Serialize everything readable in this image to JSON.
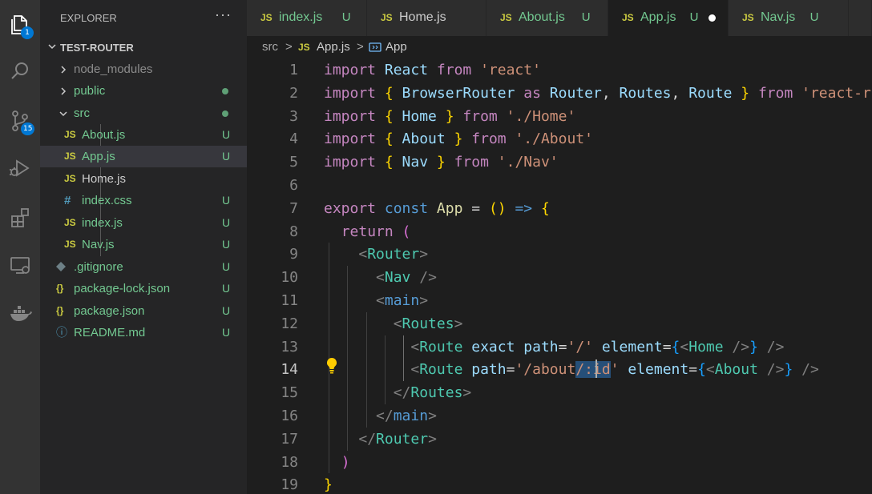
{
  "activity_bar": {
    "items": [
      {
        "icon": "explorer-icon",
        "badge": "1"
      },
      {
        "icon": "search-icon",
        "badge": ""
      },
      {
        "icon": "source-control-icon",
        "badge": "15"
      },
      {
        "icon": "run-debug-icon",
        "badge": ""
      },
      {
        "icon": "extensions-icon",
        "badge": ""
      },
      {
        "icon": "remote-explorer-icon",
        "badge": ""
      },
      {
        "icon": "docker-icon",
        "badge": ""
      }
    ],
    "badge_color": "#0078d4"
  },
  "sidebar": {
    "title": "EXPLORER",
    "more": "···",
    "root": "TEST-ROUTER",
    "rows": [
      {
        "name": "node_modules",
        "type": "folder",
        "status": ""
      },
      {
        "name": "public",
        "type": "folder",
        "status": "dot"
      },
      {
        "name": "src",
        "type": "folder-open",
        "status": "dot"
      },
      {
        "name": "About.js",
        "type": "js",
        "icon_text": "JS",
        "status": "U"
      },
      {
        "name": "App.js",
        "type": "js",
        "icon_text": "JS",
        "status": "U",
        "selected": true
      },
      {
        "name": "Home.js",
        "type": "js",
        "icon_text": "JS",
        "status": ""
      },
      {
        "name": "index.css",
        "type": "css",
        "icon_text": "#",
        "status": "U"
      },
      {
        "name": "index.js",
        "type": "js",
        "icon_text": "JS",
        "status": "U"
      },
      {
        "name": "Nav.js",
        "type": "js",
        "icon_text": "JS",
        "status": "U"
      },
      {
        "name": ".gitignore",
        "type": "git",
        "icon_text": "",
        "status": "U"
      },
      {
        "name": "package-lock.json",
        "type": "json",
        "icon_text": "{}",
        "status": "U"
      },
      {
        "name": "package.json",
        "type": "json",
        "icon_text": "{}",
        "status": "U"
      },
      {
        "name": "README.md",
        "type": "md",
        "icon_text": "ⓘ",
        "status": "U"
      }
    ],
    "colors": {
      "untracked": "#73c991",
      "js_icon": "#cbcb41",
      "css_icon": "#519aba",
      "json_icon": "#cbcb41",
      "md_icon": "#519aba"
    }
  },
  "tabs": [
    {
      "icon_text": "JS",
      "label": "index.js",
      "status": "U",
      "active": false
    },
    {
      "icon_text": "JS",
      "label": "Home.js",
      "status": "",
      "active": false
    },
    {
      "icon_text": "JS",
      "label": "About.js",
      "status": "U",
      "active": false
    },
    {
      "icon_text": "JS",
      "label": "App.js",
      "status": "U",
      "active": true,
      "modified": true
    },
    {
      "icon_text": "JS",
      "label": "Nav.js",
      "status": "U",
      "active": false
    }
  ],
  "breadcrumb": {
    "folder": "src",
    "sep": ">",
    "file_icon": "JS",
    "file": "App.js",
    "symbol": "App"
  },
  "editor": {
    "current_line": 14,
    "lines": [
      {
        "n": "1",
        "tokens": [
          [
            "kw",
            "import "
          ],
          [
            "id",
            "React "
          ],
          [
            "kw",
            "from "
          ],
          [
            "str",
            "'react'"
          ]
        ]
      },
      {
        "n": "2",
        "tokens": [
          [
            "kw",
            "import "
          ],
          [
            "br1",
            "{ "
          ],
          [
            "id",
            "BrowserRouter "
          ],
          [
            "kw",
            "as "
          ],
          [
            "id",
            "Router"
          ],
          [
            "op",
            ", "
          ],
          [
            "id",
            "Routes"
          ],
          [
            "op",
            ", "
          ],
          [
            "id",
            "Route "
          ],
          [
            "br1",
            "} "
          ],
          [
            "kw",
            "from "
          ],
          [
            "str",
            "'react-router-dom'"
          ]
        ]
      },
      {
        "n": "3",
        "tokens": [
          [
            "kw",
            "import "
          ],
          [
            "br1",
            "{ "
          ],
          [
            "id",
            "Home "
          ],
          [
            "br1",
            "} "
          ],
          [
            "kw",
            "from "
          ],
          [
            "str",
            "'./Home'"
          ]
        ]
      },
      {
        "n": "4",
        "tokens": [
          [
            "kw",
            "import "
          ],
          [
            "br1",
            "{ "
          ],
          [
            "id",
            "About "
          ],
          [
            "br1",
            "} "
          ],
          [
            "kw",
            "from "
          ],
          [
            "str",
            "'./About'"
          ]
        ]
      },
      {
        "n": "5",
        "tokens": [
          [
            "kw",
            "import "
          ],
          [
            "br1",
            "{ "
          ],
          [
            "id",
            "Nav "
          ],
          [
            "br1",
            "} "
          ],
          [
            "kw",
            "from "
          ],
          [
            "str",
            "'./Nav'"
          ]
        ]
      },
      {
        "n": "6",
        "tokens": []
      },
      {
        "n": "7",
        "tokens": [
          [
            "kw",
            "export "
          ],
          [
            "kd",
            "const "
          ],
          [
            "fn",
            "App "
          ],
          [
            "op",
            "= "
          ],
          [
            "br1",
            "() "
          ],
          [
            "kd",
            "=> "
          ],
          [
            "br1",
            "{"
          ]
        ]
      },
      {
        "n": "8",
        "tokens": [
          [
            "op",
            "  "
          ],
          [
            "kw",
            "return "
          ],
          [
            "br2",
            "("
          ]
        ]
      },
      {
        "n": "9",
        "tokens": [
          [
            "op",
            "    "
          ],
          [
            "pun",
            "<"
          ],
          [
            "tag",
            "Router"
          ],
          [
            "pun",
            ">"
          ]
        ]
      },
      {
        "n": "10",
        "tokens": [
          [
            "op",
            "      "
          ],
          [
            "pun",
            "<"
          ],
          [
            "tag",
            "Nav "
          ],
          [
            "pun",
            "/>"
          ]
        ]
      },
      {
        "n": "11",
        "tokens": [
          [
            "op",
            "      "
          ],
          [
            "pun",
            "<"
          ],
          [
            "kd",
            "main"
          ],
          [
            "pun",
            ">"
          ]
        ]
      },
      {
        "n": "12",
        "tokens": [
          [
            "op",
            "        "
          ],
          [
            "pun",
            "<"
          ],
          [
            "tag",
            "Routes"
          ],
          [
            "pun",
            ">"
          ]
        ]
      },
      {
        "n": "13",
        "tokens": [
          [
            "op",
            "          "
          ],
          [
            "pun",
            "<"
          ],
          [
            "tag",
            "Route "
          ],
          [
            "id",
            "exact "
          ],
          [
            "id",
            "path"
          ],
          [
            "op",
            "="
          ],
          [
            "str",
            "'/' "
          ],
          [
            "id",
            "element"
          ],
          [
            "op",
            "="
          ],
          [
            "br3",
            "{"
          ],
          [
            "pun",
            "<"
          ],
          [
            "tag",
            "Home "
          ],
          [
            "pun",
            "/>"
          ],
          [
            "br3",
            "} "
          ],
          [
            "pun",
            "/>"
          ]
        ]
      },
      {
        "n": "14",
        "tokens": [
          [
            "op",
            "          "
          ],
          [
            "pun",
            "<"
          ],
          [
            "tag",
            "Route "
          ],
          [
            "id",
            "path"
          ],
          [
            "op",
            "="
          ],
          [
            "str",
            "'/about"
          ],
          [
            "sel",
            "/:id"
          ],
          [
            "str",
            "' "
          ],
          [
            "id",
            "element"
          ],
          [
            "op",
            "="
          ],
          [
            "br3",
            "{"
          ],
          [
            "pun",
            "<"
          ],
          [
            "tag",
            "About "
          ],
          [
            "pun",
            "/>"
          ],
          [
            "br3",
            "} "
          ],
          [
            "pun",
            "/>"
          ]
        ]
      },
      {
        "n": "15",
        "tokens": [
          [
            "op",
            "        "
          ],
          [
            "pun",
            "</"
          ],
          [
            "tag",
            "Routes"
          ],
          [
            "pun",
            ">"
          ]
        ]
      },
      {
        "n": "16",
        "tokens": [
          [
            "op",
            "      "
          ],
          [
            "pun",
            "</"
          ],
          [
            "kd",
            "main"
          ],
          [
            "pun",
            ">"
          ]
        ]
      },
      {
        "n": "17",
        "tokens": [
          [
            "op",
            "    "
          ],
          [
            "pun",
            "</"
          ],
          [
            "tag",
            "Router"
          ],
          [
            "pun",
            ">"
          ]
        ]
      },
      {
        "n": "18",
        "tokens": [
          [
            "op",
            "  "
          ],
          [
            "br2",
            ")"
          ]
        ]
      },
      {
        "n": "19",
        "tokens": [
          [
            "br1",
            "}"
          ]
        ]
      }
    ]
  }
}
